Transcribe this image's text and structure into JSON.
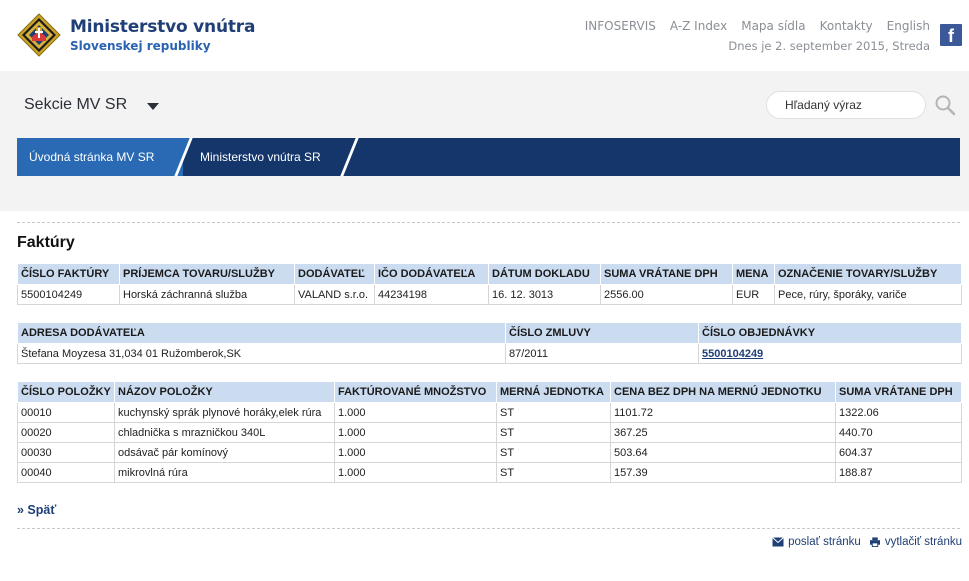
{
  "header": {
    "logo_title": "Ministerstvo vnútra",
    "logo_subtitle": "Slovenskej republiky",
    "links": [
      "INFOSERVIS",
      "A-Z Index",
      "Mapa sídla",
      "Kontakty",
      "English"
    ],
    "date": "Dnes je 2. september 2015, Streda",
    "facebook_glyph": "f"
  },
  "nav": {
    "sections_label": "Sekcie MV SR",
    "search_placeholder": "Hľadaný výraz",
    "breadcrumbs": [
      "Úvodná stránka MV SR",
      "Ministerstvo vnútra SR"
    ]
  },
  "page": {
    "title": "Faktúry",
    "back_label": "» Späť",
    "send_label": "poslať stránku",
    "print_label": "vytlačiť stránku"
  },
  "invoice": {
    "headers": [
      "ČÍSLO FAKTÚRY",
      "PRÍJEMCA TOVARU/SLUŽBY",
      "DODÁVATEĽ",
      "IČO DODÁVATEĽA",
      "DÁTUM DOKLADU",
      "SUMA VRÁTANE DPH",
      "MENA",
      "OZNAČENIE TOVARY/SLUŽBY"
    ],
    "row": [
      "5500104249",
      "Horská záchranná služba",
      "VALAND s.r.o.",
      "44234198",
      "16. 12. 3013",
      "2556.00",
      "EUR",
      "Pece, rúry, šporáky, variče"
    ]
  },
  "supplier": {
    "headers": [
      "ADRESA DODÁVATEĽA",
      "ČÍSLO ZMLUVY",
      "ČÍSLO OBJEDNÁVKY"
    ],
    "address": "Štefana Moyzesa 31,034 01 Ružomberok,SK",
    "contract": "87/2011",
    "order": "5500104249"
  },
  "items": {
    "headers": [
      "ČÍSLO POLOŽKY",
      "NÁZOV POLOŽKY",
      "FAKTÚROVANÉ MNOŽSTVO",
      "MERNÁ JEDNOTKA",
      "CENA BEZ DPH NA MERNÚ JEDNOTKU",
      "SUMA VRÁTANE DPH"
    ],
    "rows": [
      [
        "00010",
        "kuchynský sprák plynové horáky,elek rúra",
        "1.000",
        "ST",
        "1101.72",
        "1322.06"
      ],
      [
        "00020",
        "chladnička s mrazničkou 340L",
        "1.000",
        "ST",
        "367.25",
        "440.70"
      ],
      [
        "00030",
        "odsávač pár komínový",
        "1.000",
        "ST",
        "503.64",
        "604.37"
      ],
      [
        "00040",
        "mikrovlná rúra",
        "1.000",
        "ST",
        "157.39",
        "188.87"
      ]
    ]
  },
  "icons": {
    "emblem": "ministry-emblem-icon",
    "search": "search-icon",
    "caret": "caret-down-icon",
    "mail": "mail-icon",
    "print": "print-icon"
  },
  "colors": {
    "brand_dark": "#14366a",
    "brand_mid": "#2a6ab4",
    "table_header": "#cbdcf0",
    "link": "#1f3f76",
    "facebook": "#3b5998"
  }
}
